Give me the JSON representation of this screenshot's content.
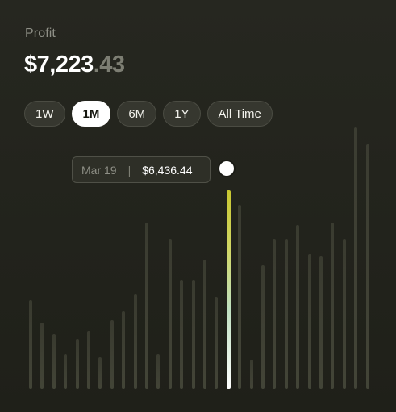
{
  "header": {
    "label": "Profit",
    "amount_main": "$7,223",
    "amount_cents": ".43"
  },
  "filters": [
    {
      "label": "1W",
      "active": false
    },
    {
      "label": "1M",
      "active": true
    },
    {
      "label": "6M",
      "active": false
    },
    {
      "label": "1Y",
      "active": false
    },
    {
      "label": "All Time",
      "active": false
    }
  ],
  "tooltip": {
    "date": "Mar 19",
    "separator": "|",
    "value": "$6,436.44"
  },
  "chart_data": {
    "type": "bar",
    "series": [
      {
        "values": [
          0.31,
          0.23,
          0.19,
          0.12,
          0.17,
          0.2,
          0.11,
          0.24,
          0.27,
          0.33,
          0.58,
          0.12,
          0.52,
          0.38,
          0.38,
          0.45,
          0.32,
          0.69,
          0.64,
          0.1,
          0.43,
          0.52,
          0.52,
          0.57,
          0.47,
          0.46,
          0.58,
          0.52,
          0.91,
          0.85
        ]
      }
    ],
    "highlight_index": 17,
    "ylim": [
      0,
      1
    ]
  },
  "colors": {
    "background": "#222319",
    "bar": "#5a5b4c",
    "highlight_top": "#c8c730",
    "highlight_bottom": "#ffffff"
  }
}
